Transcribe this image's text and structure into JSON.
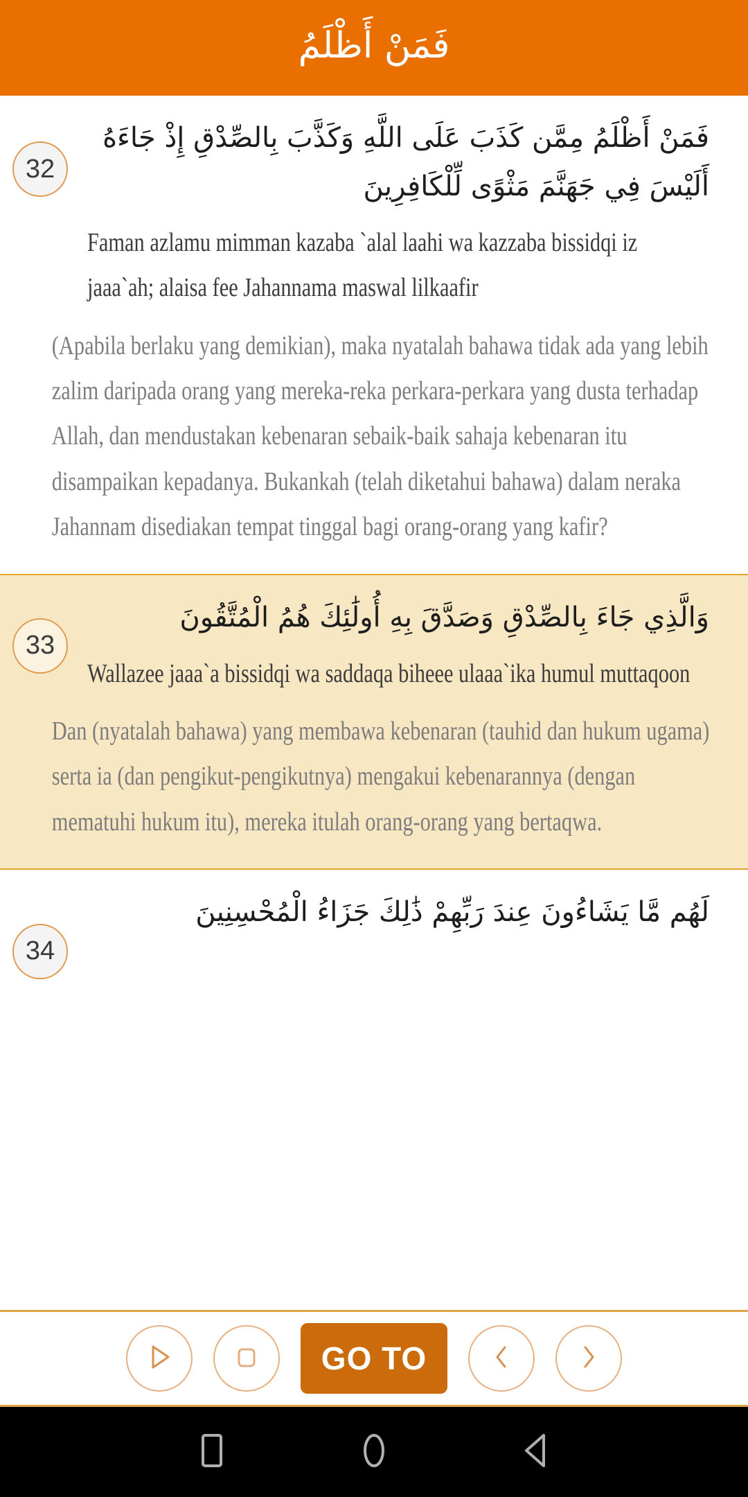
{
  "app": {
    "header": {
      "title": "فَمَنْ أَظْلَمُ",
      "bg_color": "#e97000",
      "text_color": "#ffffff"
    },
    "accent_color": "#e97000",
    "highlight_color": "#f8e7c3",
    "goto_button_color": "#cc6b0b",
    "badge_border_color": "#e09a4e"
  },
  "verses": [
    {
      "number": "32",
      "arabic": "فَمَنْ أَظْلَمُ مِمَّن كَذَبَ عَلَى اللَّهِ وَكَذَّبَ بِالصِّدْقِ إِذْ جَاءَهُ أَلَيْسَ فِي جَهَنَّمَ مَثْوًى لِّلْكَافِرِينَ",
      "transliteration": "Faman azlamu mimman kazaba `alal laahi wa kazzaba bissidqi iz jaaa`ah; alaisa fee Jahannama maswal lilkaafir",
      "translation": "(Apabila berlaku yang demikian), maka nyatalah bahawa tidak ada yang lebih zalim daripada orang yang mereka-reka perkara-perkara yang dusta terhadap Allah, dan mendustakan kebenaran sebaik-baik sahaja kebenaran itu disampaikan kepadanya. Bukankah (telah diketahui bahawa) dalam neraka Jahannam disediakan tempat tinggal bagi orang-orang yang kafir?",
      "highlighted": false
    },
    {
      "number": "33",
      "arabic": "وَالَّذِي جَاءَ بِالصِّدْقِ وَصَدَّقَ بِهِ أُولَٰئِكَ هُمُ الْمُتَّقُونَ",
      "transliteration": "Wallazee jaaa`a bissidqi wa saddaqa biheee ulaaa`ika humul muttaqoon",
      "translation": "Dan (nyatalah bahawa) yang membawa kebenaran (tauhid dan hukum ugama) serta ia (dan pengikut-pengikutnya) mengakui kebenarannya (dengan mematuhi hukum itu), mereka itulah orang-orang yang bertaqwa.",
      "highlighted": true
    },
    {
      "number": "34",
      "arabic": "لَهُم مَّا يَشَاءُونَ عِندَ رَبِّهِمْ ذَٰلِكَ جَزَاءُ الْمُحْسِنِينَ",
      "transliteration": "",
      "translation": "",
      "highlighted": false
    }
  ],
  "toolbar": {
    "play_label": "play-icon",
    "stop_label": "stop-icon",
    "goto_label": "GO TO",
    "previous_label": "chevron-left-icon",
    "next_label": "chevron-right-icon"
  },
  "navbar": {
    "recents_label": "recents-square-icon",
    "home_label": "home-circle-icon",
    "back_label": "back-triangle-icon"
  }
}
